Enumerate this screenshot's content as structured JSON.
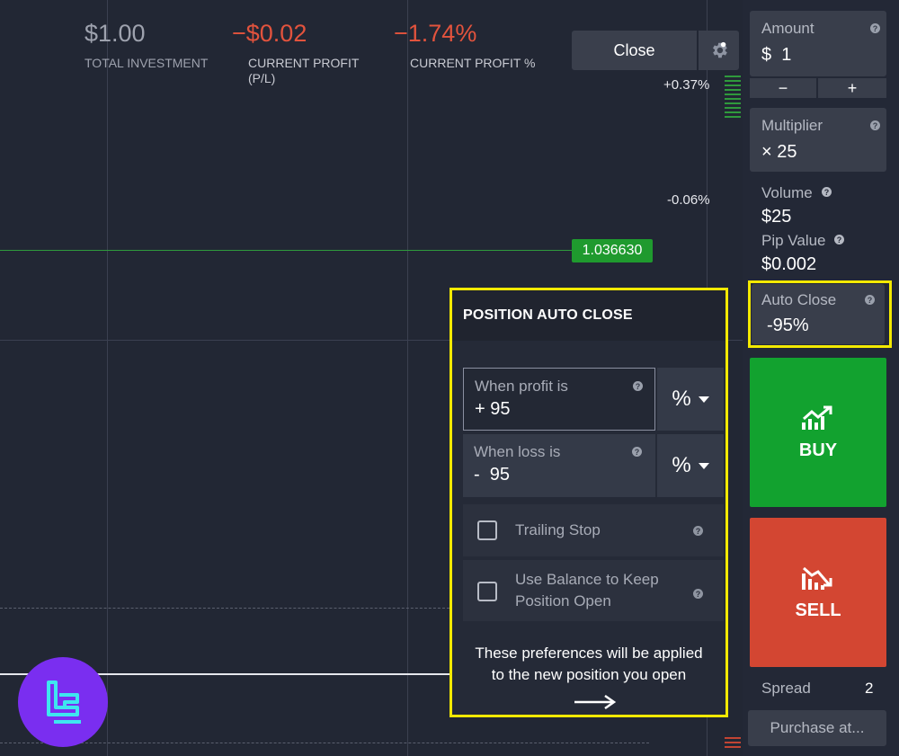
{
  "header": {
    "total_investment": {
      "value": "$1.00",
      "label": "TOTAL INVESTMENT"
    },
    "current_profit": {
      "value": "−$0.02",
      "label_line1": "CURRENT PROFIT",
      "label_line2": "(P/L)"
    },
    "current_profit_pct": {
      "value": "−1.74%",
      "label": "CURRENT PROFIT %"
    },
    "close_button": "Close"
  },
  "chart": {
    "upper_pct": "+0.37%",
    "lower_pct": "-0.06%",
    "price": "1.036630"
  },
  "auto_close_popup": {
    "title": "POSITION AUTO CLOSE",
    "profit_field": {
      "label": "When profit is",
      "value": "+ 95",
      "unit": "%"
    },
    "loss_field": {
      "label": "When loss is",
      "value": "-  95",
      "unit": "%"
    },
    "trailing_stop": {
      "label": "Trailing Stop",
      "checked": false
    },
    "use_balance": {
      "label_line1": "Use Balance to Keep",
      "label_line2": "Position Open",
      "checked": false
    },
    "note_line1": "These preferences will be applied",
    "note_line2": "to the new position you open"
  },
  "panel": {
    "amount": {
      "label": "Amount",
      "value": "$  1",
      "minus": "−",
      "plus": "+"
    },
    "multiplier": {
      "label": "Multiplier",
      "value": "× 25"
    },
    "volume": {
      "label": "Volume",
      "value": "$25"
    },
    "pip_value": {
      "label": "Pip Value",
      "value": "$0.002"
    },
    "auto_close": {
      "label": "Auto Close",
      "value": "-95%"
    },
    "buy_label": "BUY",
    "sell_label": "SELL",
    "spread": {
      "label": "Spread",
      "value": "2"
    },
    "purchase_button": "Purchase at..."
  },
  "colors": {
    "buy": "#12a22f",
    "sell": "#d34632",
    "highlight": "#f3e900",
    "loss_text": "#e2533d",
    "price_tag": "#1f9a2e"
  }
}
